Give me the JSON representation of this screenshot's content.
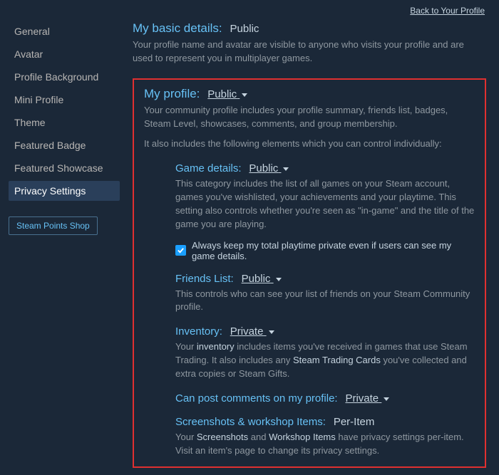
{
  "header": {
    "back_link": "Back to Your Profile"
  },
  "sidebar": {
    "items": [
      {
        "label": "General"
      },
      {
        "label": "Avatar"
      },
      {
        "label": "Profile Background"
      },
      {
        "label": "Mini Profile"
      },
      {
        "label": "Theme"
      },
      {
        "label": "Featured Badge"
      },
      {
        "label": "Featured Showcase"
      },
      {
        "label": "Privacy Settings"
      }
    ],
    "points_shop": "Steam Points Shop"
  },
  "basic": {
    "title": "My basic details:",
    "value": "Public",
    "desc": "Your profile name and avatar are visible to anyone who visits your profile and are used to represent you in multiplayer games."
  },
  "profile": {
    "title": "My profile:",
    "value": "Public",
    "desc": "Your community profile includes your profile summary, friends list, badges, Steam Level, showcases, comments, and group membership.",
    "desc2": "It also includes the following elements which you can control individually:",
    "game": {
      "title": "Game details:",
      "value": "Public",
      "desc": "This category includes the list of all games on your Steam account, games you've wishlisted, your achievements and your playtime. This setting also controls whether you're seen as \"in-game\" and the title of the game you are playing.",
      "checkbox_label": "Always keep my total playtime private even if users can see my game details."
    },
    "friends": {
      "title": "Friends List:",
      "value": "Public",
      "desc": "This controls who can see your list of friends on your Steam Community profile."
    },
    "inventory": {
      "title": "Inventory:",
      "value": "Private",
      "d1": "Your ",
      "d2": "inventory",
      "d3": " includes items you've received in games that use Steam Trading. It also includes any ",
      "d4": "Steam Trading Cards",
      "d5": " you've collected and extra copies or Steam Gifts."
    },
    "comments": {
      "title": "Can post comments on my profile:",
      "value": "Private"
    },
    "screens": {
      "title": "Screenshots & workshop Items:",
      "value": "Per-Item",
      "d1": "Your ",
      "d2": "Screenshots",
      "d3": " and ",
      "d4": "Workshop Items",
      "d5": " have privacy settings per-item. Visit an item's page to change its privacy settings."
    }
  }
}
